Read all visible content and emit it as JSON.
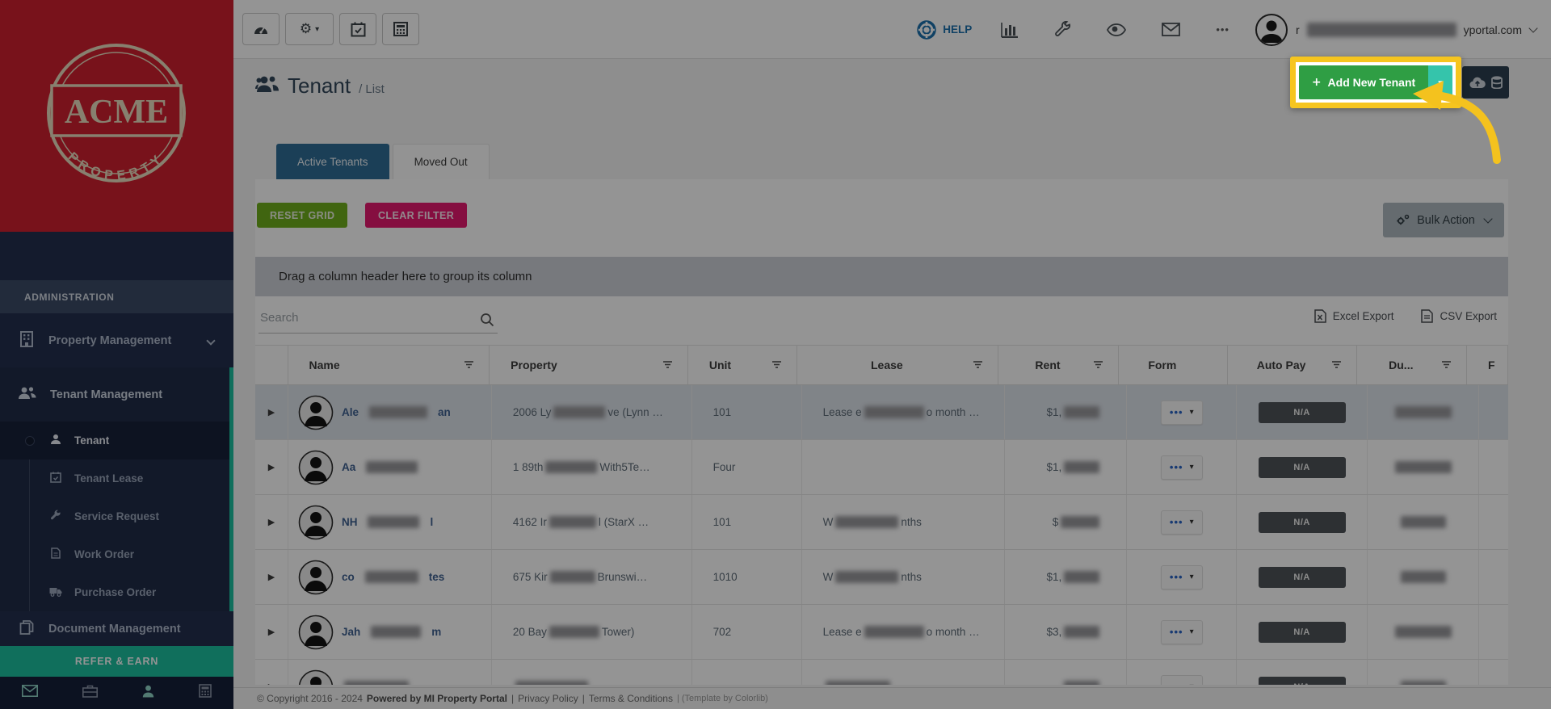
{
  "topbar": {
    "help_label": "HELP",
    "user_email_prefix": "r",
    "user_email_visible": "yportal.com"
  },
  "sidebar": {
    "logo_line1": "ACME",
    "logo_line2": "PROPERTY",
    "section": "ADMINISTRATION",
    "item_property": "Property Management",
    "item_tenant": "Tenant Management",
    "subitems": [
      "Tenant",
      "Tenant Lease",
      "Service Request",
      "Work Order",
      "Purchase Order"
    ],
    "item_document": "Document Management",
    "refer_banner": "REFER & EARN"
  },
  "page": {
    "title": "Tenant",
    "breadcrumb": "/ List",
    "add_button": "Add New Tenant",
    "tab_active": "Active Tenants",
    "tab_idle": "Moved Out",
    "reset_grid": "RESET GRID",
    "clear_filter": "CLEAR FILTER",
    "bulk_action": "Bulk Action",
    "group_hint": "Drag a column header here to group its column",
    "search_placeholder": "Search",
    "excel_export": "Excel Export",
    "csv_export": "CSV Export"
  },
  "glyphs": {
    "gear": "⚙",
    "caret": "▾",
    "dots": "•••",
    "more": "•••",
    "expander": "▶",
    "plus": "+"
  },
  "table": {
    "columns": [
      {
        "label": "",
        "filter": false
      },
      {
        "label": "Name",
        "filter": true
      },
      {
        "label": "Property",
        "filter": true
      },
      {
        "label": "Unit",
        "filter": true
      },
      {
        "label": "Lease",
        "filter": true
      },
      {
        "label": "Rent",
        "filter": true
      },
      {
        "label": "Form",
        "filter": false
      },
      {
        "label": "Auto Pay",
        "filter": true
      },
      {
        "label": "Du...",
        "filter": true
      },
      {
        "label": "F",
        "filter": false
      }
    ],
    "na_label": "N/A",
    "rows": [
      {
        "selected": true,
        "name": [
          {
            "text": "Ale"
          },
          {
            "redact": 72
          },
          {
            "text": "an"
          }
        ],
        "property": [
          {
            "text": "2006 Ly"
          },
          {
            "redact": 64
          },
          {
            "text": "ve (Lynn …"
          }
        ],
        "unit": "101",
        "lease": [
          {
            "text": "Lease e"
          },
          {
            "redact": 74
          },
          {
            "text": "o month …"
          }
        ],
        "rent": [
          {
            "text": "$1,"
          },
          {
            "redact": 44
          }
        ],
        "due": [
          {
            "redact": 70
          }
        ],
        "p": [
          {
            "redact": 40
          }
        ]
      },
      {
        "selected": false,
        "name": [
          {
            "text": "Aa"
          },
          {
            "redact": 64
          }
        ],
        "property": [
          {
            "text": "1 89th "
          },
          {
            "redact": 64
          },
          {
            "text": "With5Te…"
          }
        ],
        "unit": "Four",
        "lease": [],
        "rent": [
          {
            "text": "$1,"
          },
          {
            "redact": 44
          }
        ],
        "due": [
          {
            "redact": 70
          }
        ],
        "p": [
          {
            "redact": 40
          }
        ]
      },
      {
        "selected": false,
        "name": [
          {
            "text": "NH"
          },
          {
            "redact": 64
          },
          {
            "text": "l"
          }
        ],
        "property": [
          {
            "text": "4162 Ir"
          },
          {
            "redact": 58
          },
          {
            "text": "l (StarX …"
          }
        ],
        "unit": "101",
        "lease": [
          {
            "text": "W"
          },
          {
            "redact": 78
          },
          {
            "text": "nths"
          }
        ],
        "rent": [
          {
            "text": "$"
          },
          {
            "redact": 48
          }
        ],
        "due": [
          {
            "redact": 56
          }
        ],
        "p": [
          {
            "redact": 40
          }
        ]
      },
      {
        "selected": false,
        "name": [
          {
            "text": "co"
          },
          {
            "redact": 66
          },
          {
            "text": "tes"
          }
        ],
        "property": [
          {
            "text": "675 Kir"
          },
          {
            "redact": 56
          },
          {
            "text": "Brunswi…"
          }
        ],
        "unit": "1010",
        "lease": [
          {
            "text": "W"
          },
          {
            "redact": 78
          },
          {
            "text": "nths"
          }
        ],
        "rent": [
          {
            "text": "$1,"
          },
          {
            "redact": 44
          }
        ],
        "due": [
          {
            "redact": 56
          }
        ],
        "p": [
          {
            "redact": 40
          }
        ]
      },
      {
        "selected": false,
        "name": [
          {
            "text": "Jah"
          },
          {
            "redact": 62
          },
          {
            "text": "m"
          }
        ],
        "property": [
          {
            "text": "20 Bay"
          },
          {
            "redact": 62
          },
          {
            "text": "Tower)"
          }
        ],
        "unit": "702",
        "lease": [
          {
            "text": "Lease e"
          },
          {
            "redact": 74
          },
          {
            "text": "o month …"
          }
        ],
        "rent": [
          {
            "text": "$3,"
          },
          {
            "redact": 44
          }
        ],
        "due": [
          {
            "redact": 70
          }
        ],
        "p": [
          {
            "redact": 40
          }
        ]
      },
      {
        "selected": false,
        "partial": true,
        "name": [
          {
            "redact": 80
          }
        ],
        "property": [
          {
            "redact": 90
          }
        ],
        "unit": "",
        "lease": [
          {
            "redact": 80
          }
        ],
        "rent": [
          {
            "redact": 44
          }
        ],
        "due": [
          {
            "redact": 56
          }
        ],
        "p": [
          {
            "redact": 40
          }
        ]
      }
    ]
  },
  "footer": {
    "copyright": "© Copyright 2016 - 2024",
    "powered": "Powered by MI Property Portal",
    "sep": "|",
    "privacy": "Privacy Policy",
    "terms": "Terms & Conditions",
    "template": "| (Template by Colorlib)"
  },
  "colors": {
    "brand_red": "#cf2030",
    "sidebar_navy": "#232f4e",
    "accent_teal": "#1dbf9f",
    "tab_blue": "#2f6d96",
    "reset_green": "#6fae1c",
    "filter_pink": "#e5196e",
    "add_green": "#2f9e44",
    "split_teal": "#35c4ab",
    "highlight_yellow": "#f6c51f",
    "export_navy": "#2c3e50",
    "help_blue": "#1d71ad"
  }
}
